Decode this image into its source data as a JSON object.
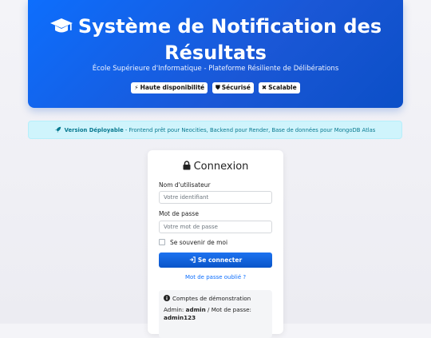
{
  "hero": {
    "title": "Système de Notification des Résultats",
    "subtitle": "École Supérieure d'Informatique - Plateforme Résiliente de Délibérations",
    "badges": [
      {
        "icon": "bolt-icon",
        "label": "Haute disponibilité"
      },
      {
        "icon": "shield-icon",
        "label": "Sécurisé"
      },
      {
        "icon": "arrows-icon",
        "label": "Scalable"
      }
    ]
  },
  "alert": {
    "icon": "rocket-icon",
    "bold": "Version Déployable",
    "text": " - Frontend prêt pour Neocities, Backend pour Render, Base de données pour MongoDB Atlas"
  },
  "login": {
    "title": "Connexion",
    "username_label": "Nom d'utilisateur",
    "username_placeholder": "Votre identifiant",
    "password_label": "Mot de passe",
    "password_placeholder": "Votre mot de passe",
    "remember_label": "Se souvenir de moi",
    "submit_label": "Se connecter",
    "forgot_link": "Mot de passe oublié ?"
  },
  "demo": {
    "title": "Comptes de démonstration",
    "admin_prefix": "Admin: ",
    "admin_user": "admin",
    "admin_middle": " / Mot de passe:",
    "admin_pass": "admin123"
  },
  "colors": {
    "primary": "#0d6efd",
    "alert_bg": "#cff4fc",
    "alert_text": "#087990"
  }
}
